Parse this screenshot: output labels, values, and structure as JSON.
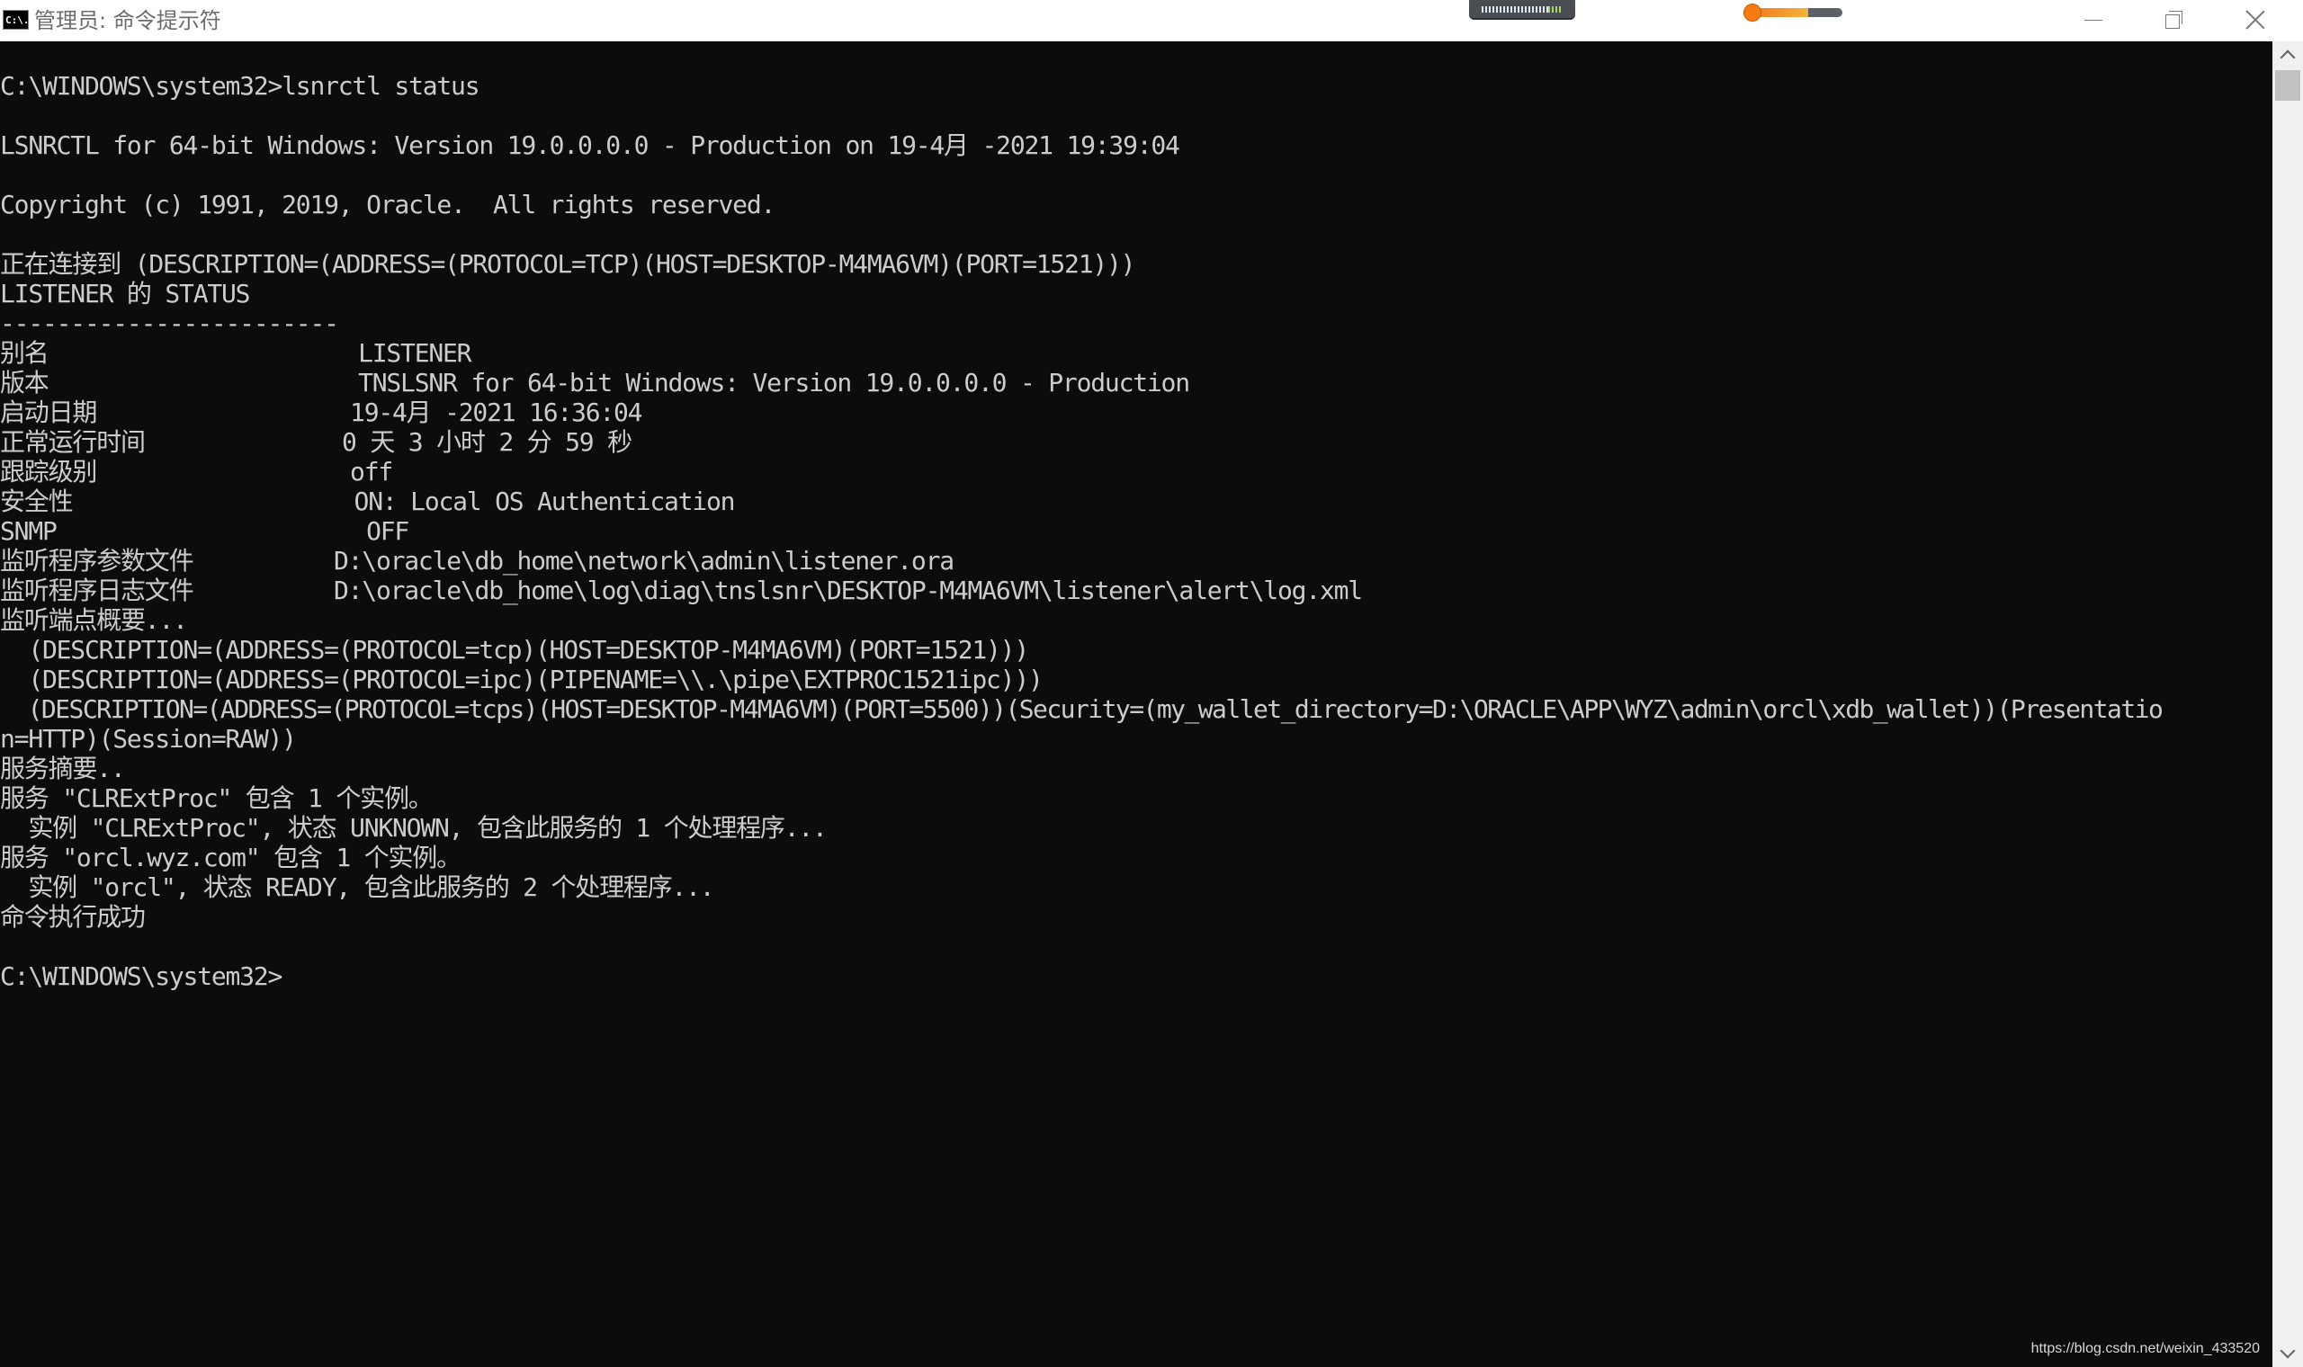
{
  "window": {
    "title": "管理员: 命令提示符",
    "icon_label": "C:\\.",
    "icon": "cmd-icon",
    "controls": [
      "minimize-icon",
      "restore-icon",
      "close-icon"
    ]
  },
  "console": {
    "lines": [
      "C:\\WINDOWS\\system32>lsnrctl status",
      "",
      "LSNRCTL for 64-bit Windows: Version 19.0.0.0.0 - Production on 19-4月 -2021 19:39:04",
      "",
      "Copyright (c) 1991, 2019, Oracle.  All rights reserved.",
      "",
      "正在连接到 (DESCRIPTION=(ADDRESS=(PROTOCOL=TCP)(HOST=DESKTOP-M4MA6VM)(PORT=1521)))",
      "LISTENER 的 STATUS",
      "------------------------",
      "别名                      LISTENER",
      "版本                      TNSLSNR for 64-bit Windows: Version 19.0.0.0.0 - Production",
      "启动日期                  19-4月 -2021 16:36:04",
      "正常运行时间              0 天 3 小时 2 分 59 秒",
      "跟踪级别                  off",
      "安全性                    ON: Local OS Authentication",
      "SNMP                      OFF",
      "监听程序参数文件          D:\\oracle\\db_home\\network\\admin\\listener.ora",
      "监听程序日志文件          D:\\oracle\\db_home\\log\\diag\\tnslsnr\\DESKTOP-M4MA6VM\\listener\\alert\\log.xml",
      "监听端点概要...",
      "  (DESCRIPTION=(ADDRESS=(PROTOCOL=tcp)(HOST=DESKTOP-M4MA6VM)(PORT=1521)))",
      "  (DESCRIPTION=(ADDRESS=(PROTOCOL=ipc)(PIPENAME=\\\\.\\pipe\\EXTPROC1521ipc)))",
      "  (DESCRIPTION=(ADDRESS=(PROTOCOL=tcps)(HOST=DESKTOP-M4MA6VM)(PORT=5500))(Security=(my_wallet_directory=D:\\ORACLE\\APP\\WYZ\\admin\\orcl\\xdb_wallet))(Presentatio",
      "n=HTTP)(Session=RAW))",
      "服务摘要..",
      "服务 \"CLRExtProc\" 包含 1 个实例。",
      "  实例 \"CLRExtProc\", 状态 UNKNOWN, 包含此服务的 1 个处理程序...",
      "服务 \"orcl.wyz.com\" 包含 1 个实例。",
      "  实例 \"orcl\", 状态 READY, 包含此服务的 2 个处理程序...",
      "命令执行成功",
      "",
      "C:\\WINDOWS\\system32>"
    ]
  },
  "scrollbar": {
    "up_icon": "chevron-up-icon",
    "down_icon": "chevron-down-icon"
  },
  "watermark": "https://blog.csdn.net/weixin_433520",
  "colors": {
    "console_bg": "#0c0c0c",
    "console_text": "#cccccc",
    "titlebar_bg": "#ffffff",
    "slider_accent": "#f57c14"
  }
}
